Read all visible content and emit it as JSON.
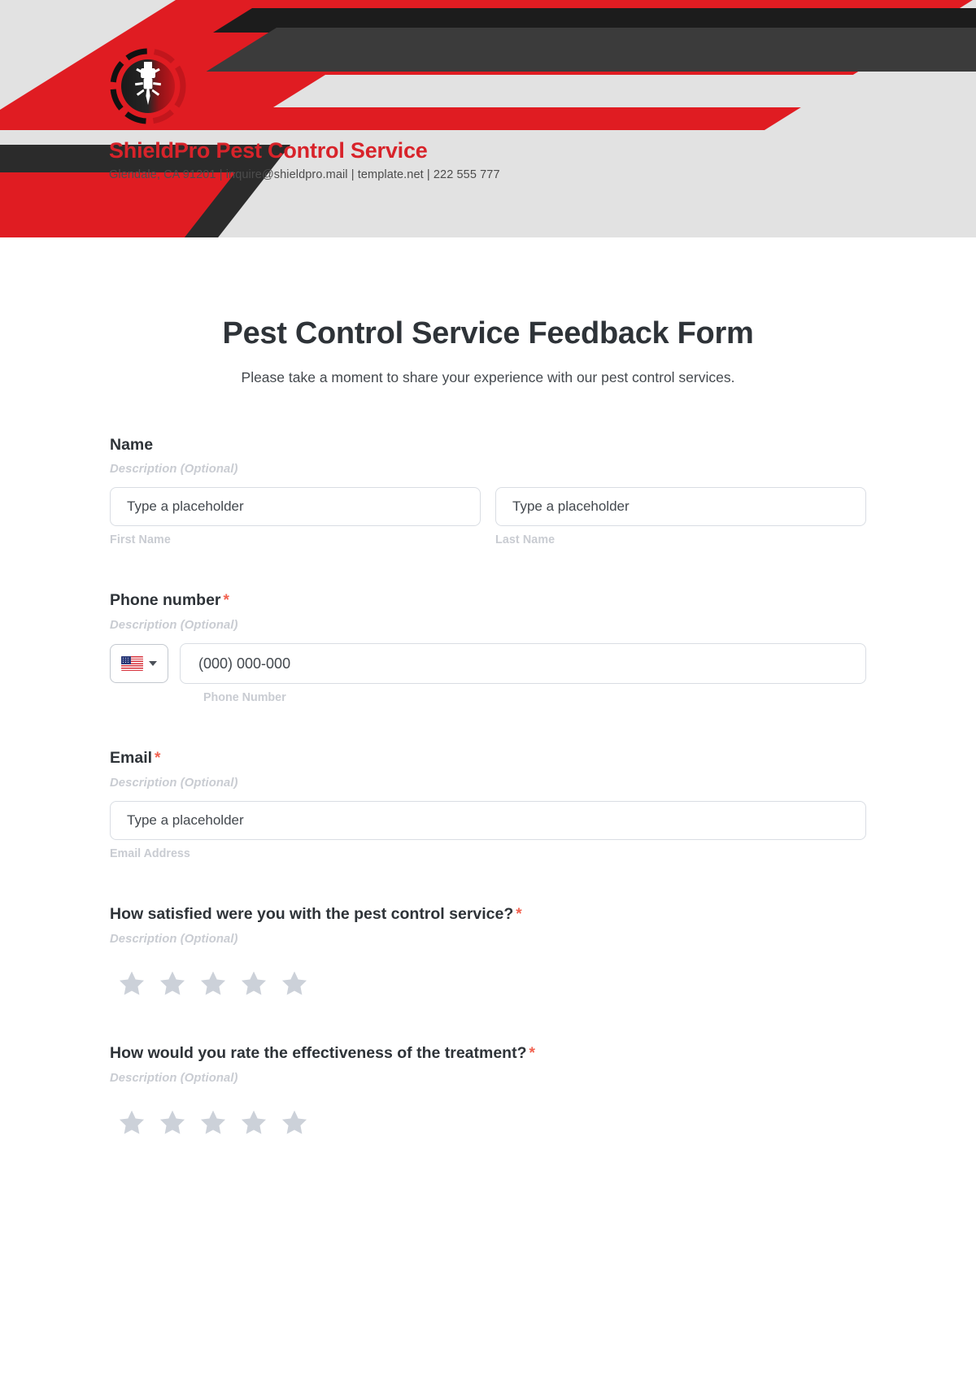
{
  "brand": {
    "logo_icon": "pest-bug-emblem-icon",
    "name": "ShieldPro Pest Control Service",
    "contact": "Glendale, CA 91201 | inquire@shieldpro.mail | template.net | 222 555 777",
    "accent_red": "#d8232a",
    "banner_bg": "#e2e2e2",
    "banner_dark": "#3b3b3b",
    "banner_black": "#1c1c1c"
  },
  "form": {
    "title": "Pest Control Service Feedback Form",
    "subtitle": "Please take a moment to share your experience with our pest control services.",
    "required_marker": "*",
    "description_placeholder": "Description (Optional)",
    "fields": {
      "name": {
        "label": "Name",
        "description": "Description (Optional)",
        "first": {
          "placeholder": "Type a placeholder",
          "value": "Type a placeholder",
          "sub_label": "First Name"
        },
        "last": {
          "placeholder": "Type a placeholder",
          "value": "Type a placeholder",
          "sub_label": "Last Name"
        }
      },
      "phone": {
        "label": "Phone number",
        "description": "Description (Optional)",
        "country_flag": "us-flag-icon",
        "country_code_selected": "US",
        "placeholder": "(000) 000-000",
        "value": "(000) 000-000",
        "sub_label": "Phone Number",
        "required": true
      },
      "email": {
        "label": "Email",
        "description": "Description (Optional)",
        "placeholder": "Type a placeholder",
        "value": "Type a placeholder",
        "sub_label": "Email Address",
        "required": true
      },
      "satisfaction": {
        "label": "How satisfied were you with the pest control service?",
        "description": "Description (Optional)",
        "required": true,
        "rating_max": 5,
        "rating_value": 0,
        "star_color": "#ccd1d9"
      },
      "effectiveness": {
        "label": "How would you rate the effectiveness of the treatment?",
        "description": "Description (Optional)",
        "required": true,
        "rating_max": 5,
        "rating_value": 0,
        "star_color": "#ccd1d9"
      }
    }
  }
}
